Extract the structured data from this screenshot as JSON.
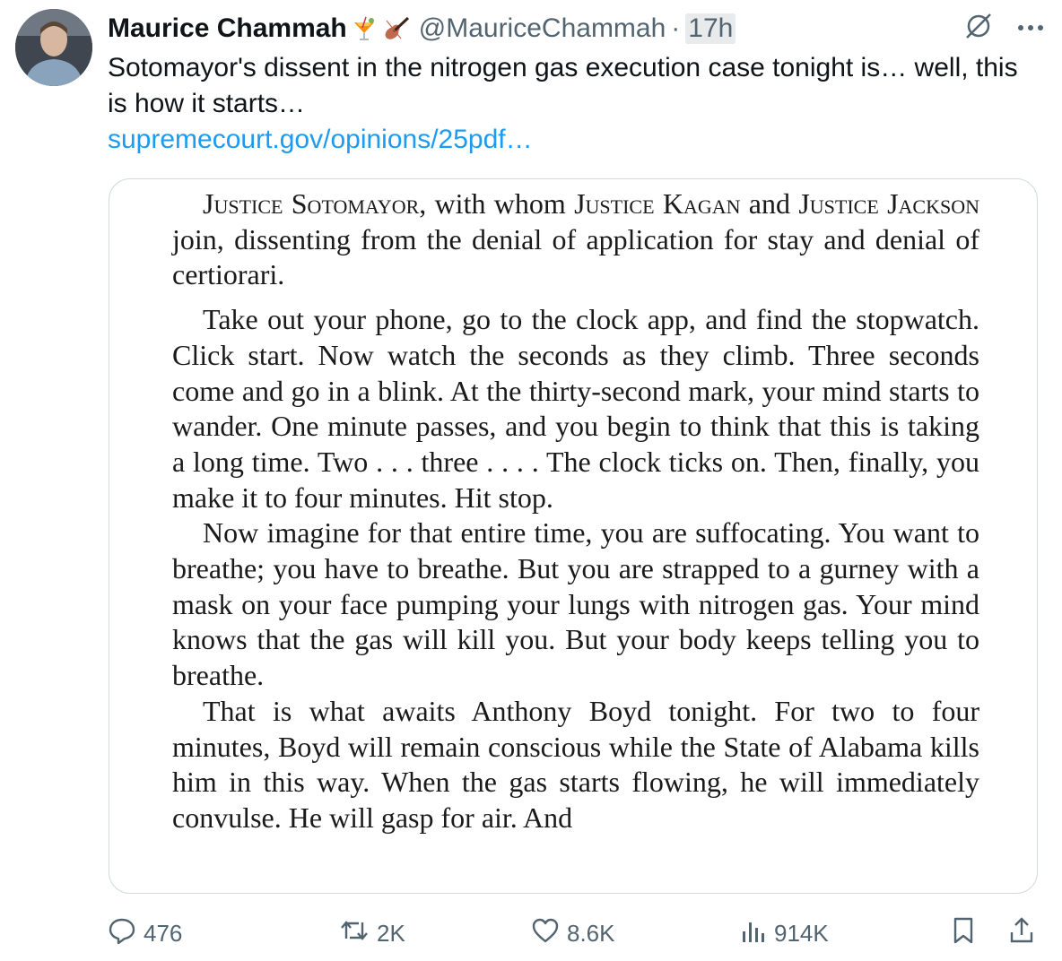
{
  "tweet": {
    "author_name": "Maurice Chammah",
    "author_handle": "@MauriceChammah",
    "separator": "·",
    "time": "17h",
    "text": "Sotomayor's dissent in the nitrogen gas execution case tonight is… well, this is how it starts…",
    "link": "supremecourt.gov/opinions/25pdf…"
  },
  "document": {
    "para1_justice1": "Justice Sotomayor",
    "para1_mid": ", with whom ",
    "para1_justice2": "Justice Kagan",
    "para1_and": " and ",
    "para1_justice3": "Justice Jackson",
    "para1_rest": " join, dissenting from the denial of application for stay and denial of certiorari.",
    "para2": "Take out your phone, go to the clock app, and find the stopwatch.  Click start.  Now watch the seconds as they climb.  Three seconds come and go in a blink.  At the thirty-second mark, your mind starts to wander.  One minute passes, and you begin to think that this is taking a long time.  Two . . . three . . . . The clock ticks on.  Then, finally, you make it to four minutes.  Hit stop.",
    "para3": "Now imagine for that entire time, you are suffocating. You want to breathe; you have to breathe.  But you are strapped to a gurney with a mask on your face pumping your lungs with nitrogen gas.  Your mind knows that the gas will kill you.  But your body keeps telling you to breathe.",
    "para4": "That is what awaits Anthony Boyd tonight.  For two to four minutes, Boyd will remain conscious while the State of Alabama kills him in this way.  When the gas starts flowing, he will immediately convulse.  He will gasp for air.  And"
  },
  "actions": {
    "replies": "476",
    "reposts": "2K",
    "likes": "8.6K",
    "views": "914K"
  },
  "icons": [
    "tropical-drink-icon",
    "violin-icon",
    "grok-icon",
    "more-icon",
    "reply-icon",
    "repost-icon",
    "like-icon",
    "views-icon",
    "bookmark-icon",
    "share-icon"
  ],
  "colors": {
    "link": "#1d9bf0",
    "muted": "#536471",
    "text": "#0f1419"
  }
}
